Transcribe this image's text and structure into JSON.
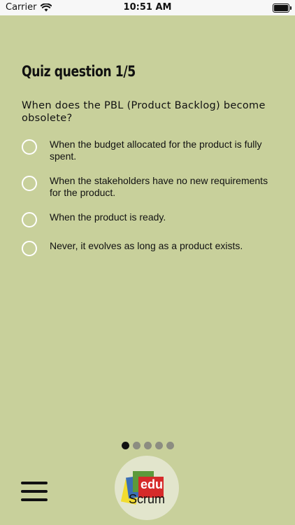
{
  "status_bar": {
    "carrier": "Carrier",
    "time": "10:51 AM"
  },
  "quiz": {
    "title": "Quiz question 1/5",
    "question": "When does the PBL (Product Backlog) become obsolete?",
    "options": [
      "When the budget allocated for the product is fully spent.",
      "When the stakeholders have no new requirements for the product.",
      "When the product is ready.",
      "Never, it evolves as long as a product exists."
    ]
  },
  "pager": {
    "total": 5,
    "current": 1
  },
  "logo": {
    "edu": "edu",
    "scrum": "Scrum"
  },
  "colors": {
    "background": "#c8d09b",
    "radio": "#ffffff",
    "dot_active": "#111111",
    "dot_inactive": "#8c8d81"
  }
}
